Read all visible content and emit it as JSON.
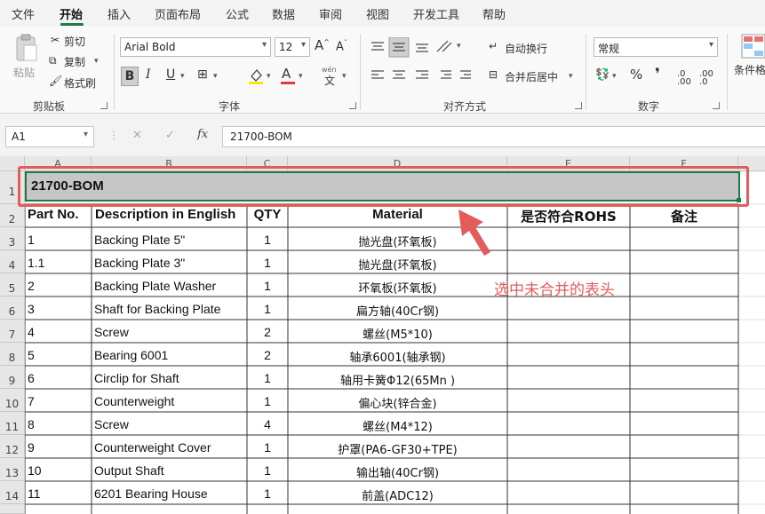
{
  "menu": [
    "文件",
    "开始",
    "插入",
    "页面布局",
    "公式",
    "数据",
    "审阅",
    "视图",
    "开发工具",
    "帮助"
  ],
  "ribbon": {
    "clipboard": {
      "paste": "粘贴",
      "cut": "剪切",
      "copy": "复制",
      "format_painter": "格式刷",
      "label": "剪贴板"
    },
    "font": {
      "name": "Arial Bold",
      "size": "12",
      "grow": "A",
      "shrink": "A",
      "bold": "B",
      "italic": "I",
      "underline": "U",
      "phonetic": "wén",
      "label": "字体"
    },
    "alignment": {
      "wrap": "自动换行",
      "merge": "合并后居中",
      "label": "对齐方式"
    },
    "number": {
      "format": "常规",
      "percent": "%",
      "comma": "❜",
      "label": "数字"
    },
    "styles": {
      "conditional": "条件格"
    }
  },
  "formula_bar": {
    "name_box": "A1",
    "cancel": "✕",
    "enter": "✓",
    "fx": "fx",
    "content": "21700-BOM"
  },
  "columns": [
    "A",
    "B",
    "C",
    "D",
    "E",
    "F"
  ],
  "rows": [
    "1",
    "2",
    "3",
    "4",
    "5",
    "6",
    "7",
    "8",
    "9",
    "10",
    "11",
    "12",
    "13",
    "14"
  ],
  "sheet": {
    "title": "21700-BOM",
    "headers": [
      "Part No.",
      "Description in English",
      "QTY",
      "Material",
      "是否符合ROHS",
      "备注"
    ],
    "data": [
      [
        "1",
        "Backing Plate 5\"",
        "1",
        "抛光盘(环氧板)"
      ],
      [
        "1.1",
        "Backing Plate 3\"",
        "1",
        "抛光盘(环氧板)"
      ],
      [
        "2",
        "Backing Plate Washer",
        "1",
        "环氧板(环氧板)"
      ],
      [
        "3",
        "Shaft for Backing Plate",
        "1",
        "扁方轴(40Cr钢)"
      ],
      [
        "4",
        "Screw",
        "2",
        "螺丝(M5*10)"
      ],
      [
        "5",
        "Bearing 6001",
        "2",
        "轴承6001(轴承钢)"
      ],
      [
        "6",
        "Circlip for Shaft",
        "1",
        "轴用卡簧Φ12(65Mn )"
      ],
      [
        "7",
        "Counterweight",
        "1",
        "偏心块(锌合金)"
      ],
      [
        "8",
        "Screw",
        "4",
        "螺丝(M4*12)"
      ],
      [
        "9",
        "Counterweight Cover",
        "1",
        "护罩(PA6-GF30+TPE)"
      ],
      [
        "10",
        "Output Shaft",
        "1",
        "输出轴(40Cr钢)"
      ],
      [
        "11",
        "6201 Bearing House",
        "1",
        "前盖(ADC12)"
      ]
    ]
  },
  "annotation": "选中未合并的表头",
  "colors": {
    "accent": "#1f7a47",
    "annotation": "#e35b5b",
    "selection": "#c6c6c6"
  }
}
